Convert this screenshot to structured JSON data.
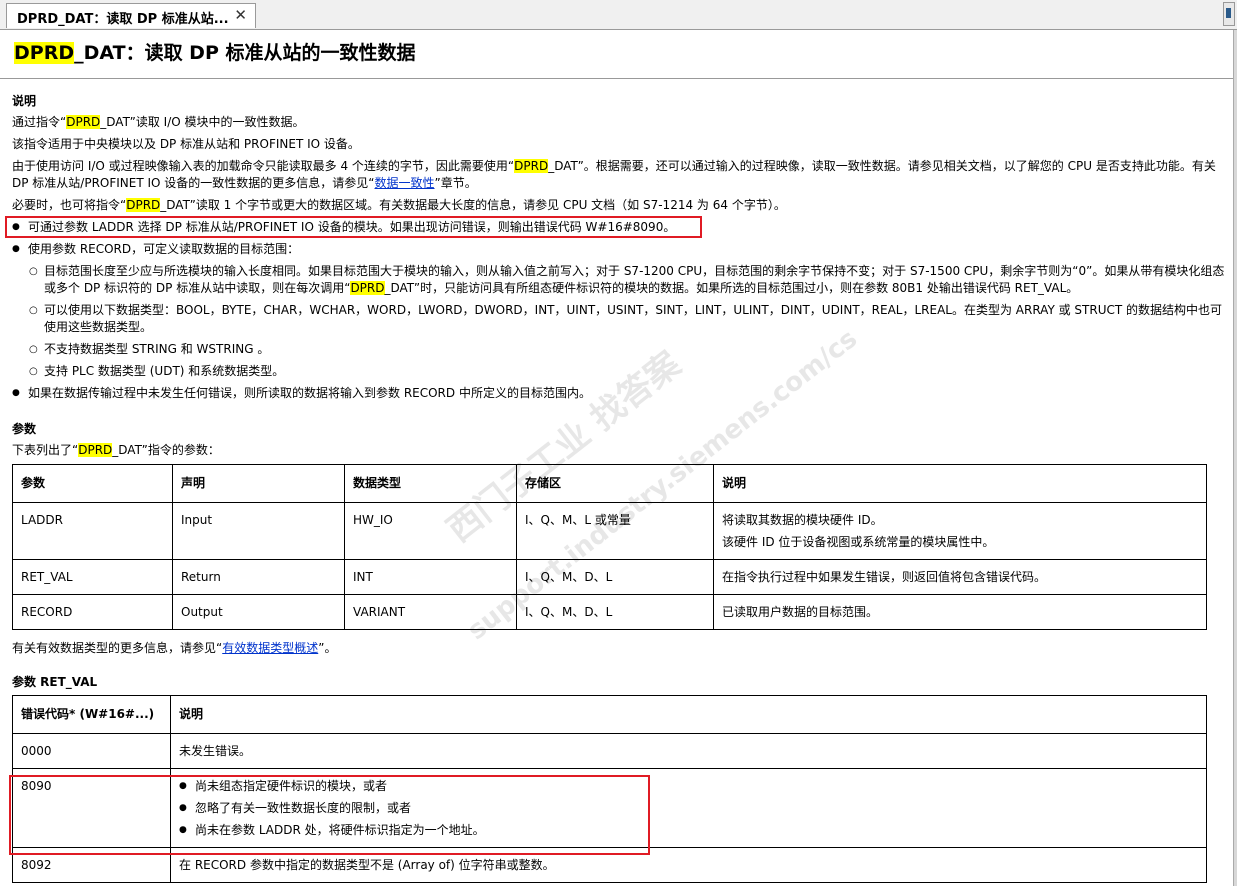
{
  "tab": {
    "title": "DPRD_DAT：读取 DP 标准从站...",
    "close": "✕"
  },
  "header": {
    "title_hl": "DPRD",
    "title_rest": "_DAT：读取 DP 标准从站的一致性数据"
  },
  "description": {
    "heading": "说明",
    "p1_pre": "通过指令“",
    "p1_hl": "DPRD",
    "p1_post": "_DAT”读取 I/O 模块中的一致性数据。",
    "p2": "该指令适用于中央模块以及 DP 标准从站和 PROFINET IO 设备。",
    "p3_pre": "由于使用访问 I/O 或过程映像输入表的加载命令只能读取最多 4 个连续的字节，因此需要使用“",
    "p3_hl": "DPRD",
    "p3_mid": "_DAT”。根据需要，还可以通过输入的过程映像，读取一致性数据。请参见相关文档，以了解您的 CPU 是否支持此功能。有关 DP 标准从站/PROFINET IO 设备的一致性数据的更多信息，请参见“",
    "p3_link": "数据一致性",
    "p3_post": "”章节。",
    "p4_pre": "必要时，也可将指令“",
    "p4_hl": "DPRD",
    "p4_post": "_DAT”读取 1 个字节或更大的数据区域。有关数据最大长度的信息，请参见 CPU 文档（如 S7-1214 为 64 个字节）。",
    "b1": "可通过参数 LADDR 选择 DP 标准从站/PROFINET IO 设备的模块。如果出现访问错误，则输出错误代码 W#16#8090。",
    "b2": "使用参数 RECORD，可定义读取数据的目标范围：",
    "s1_pre": "目标范围长度至少应与所选模块的输入长度相同。如果目标范围大于模块的输入，则从输入值之前写入；对于 S7-1200 CPU，目标范围的剩余字节保持不变；对于 S7-1500 CPU，剩余字节则为“0”。如果从带有模块化组态或多个 DP 标识符的 DP 标准从站中读取，则在每次调用“",
    "s1_hl": "DPRD",
    "s1_post": "_DAT”时，只能访问具有所组态硬件标识符的模块的数据。如果所选的目标范围过小，则在参数 80B1 处输出错误代码 RET_VAL。",
    "s2": "可以使用以下数据类型：BOOL，BYTE，CHAR，WCHAR，WORD，LWORD，DWORD，INT，UINT，USINT，SINT，LINT，ULINT，DINT，UDINT，REAL，LREAL。在类型为 ARRAY 或 STRUCT 的数据结构中也可使用这些数据类型。",
    "s3": "不支持数据类型 STRING 和 WSTRING 。",
    "s4": "支持 PLC 数据类型 (UDT) 和系统数据类型。",
    "b3": "如果在数据传输过程中未发生任何错误，则所读取的数据将输入到参数 RECORD 中所定义的目标范围内。"
  },
  "params": {
    "heading": "参数",
    "intro_pre": "下表列出了“",
    "intro_hl": "DPRD",
    "intro_post": "_DAT”指令的参数：",
    "columns": [
      "参数",
      "声明",
      "数据类型",
      "存储区",
      "说明"
    ],
    "rows": [
      {
        "name": "LADDR",
        "decl": "Input",
        "type": "HW_IO",
        "area": "I、Q、M、L 或常量",
        "desc1": "将读取其数据的模块硬件 ID。",
        "desc2": "该硬件 ID 位于设备视图或系统常量的模块属性中。"
      },
      {
        "name": "RET_VAL",
        "decl": "Return",
        "type": "INT",
        "area": "I、Q、M、D、L",
        "desc1": "在指令执行过程中如果发生错误，则返回值将包含错误代码。",
        "desc2": ""
      },
      {
        "name": "RECORD",
        "decl": "Output",
        "type": "VARIANT",
        "area": "I、Q、M、D、L",
        "desc1": "已读取用户数据的目标范围。",
        "desc2": ""
      }
    ],
    "footer_pre": "有关有效数据类型的更多信息，请参见“",
    "footer_link": "有效数据类型概述",
    "footer_post": "”。"
  },
  "retval": {
    "heading": "参数 RET_VAL",
    "columns": [
      "错误代码* (W#16#...)",
      "说明"
    ],
    "row0": {
      "code": "0000",
      "desc": "未发生错误。"
    },
    "row1": {
      "code": "8090",
      "items": [
        "尚未组态指定硬件标识的模块，或者",
        "忽略了有关一致性数据长度的限制，或者",
        "尚未在参数 LADDR 处，将硬件标识指定为一个地址。"
      ]
    },
    "row2": {
      "code": "8092",
      "desc": "在 RECORD 参数中指定的数据类型不是 (Array of) 位字符串或整数。"
    }
  },
  "watermark": {
    "line1": "西门子工业   找答案",
    "line2": "support.industry.siemens.com/cs"
  },
  "colors": {
    "highlight": "#ffff00",
    "annotation_box": "#e01b24",
    "link": "#0033cc"
  }
}
